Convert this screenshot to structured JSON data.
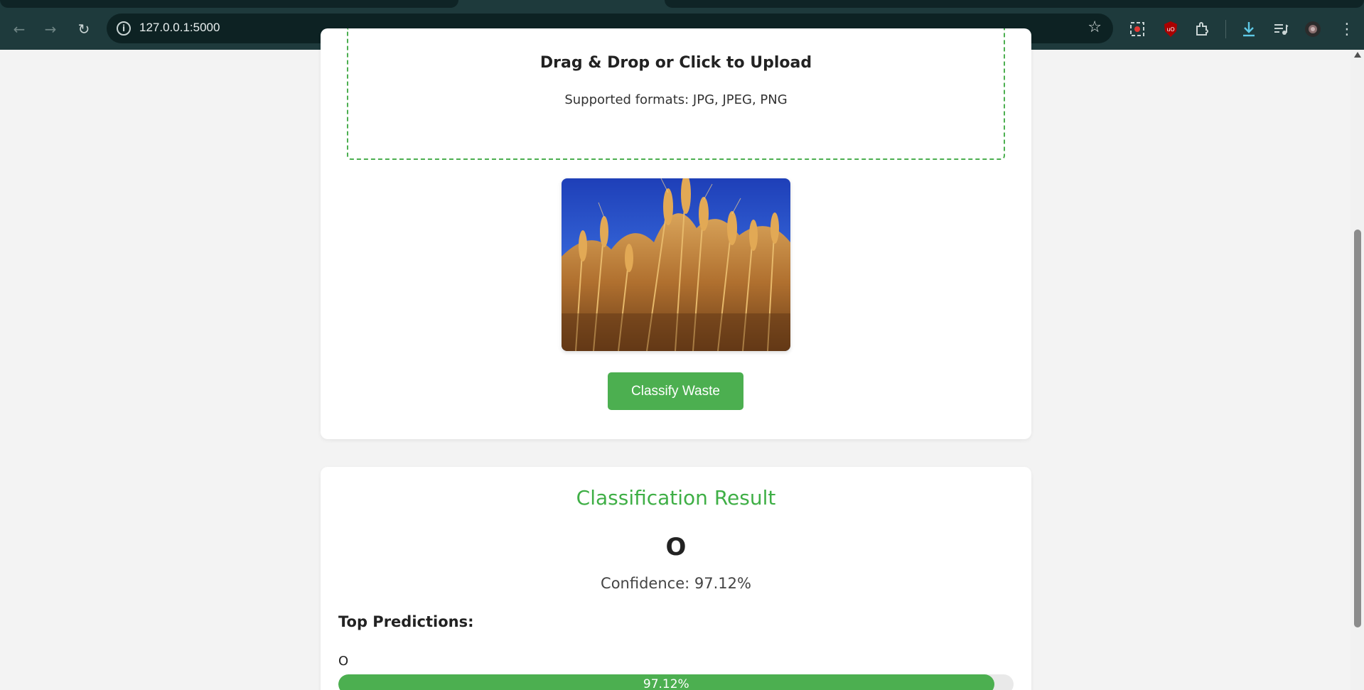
{
  "browser": {
    "url": "127.0.0.1:5000",
    "theme_color": "#1e3a3c"
  },
  "upload": {
    "title": "Drag & Drop or Click to Upload",
    "supported": "Supported formats: JPG, JPEG, PNG",
    "image_alt": "Wheat field against blue sky",
    "button_label": "Classify Waste"
  },
  "result": {
    "title": "Classification Result",
    "predicted_class": "O",
    "confidence_text": "Confidence: 97.12%",
    "top_heading": "Top Predictions:",
    "predictions": [
      {
        "label": "O",
        "percent_text": "97.12%",
        "value": 97.12
      }
    ]
  },
  "colors": {
    "accent": "#4caf50",
    "title_green": "#3faf46"
  }
}
